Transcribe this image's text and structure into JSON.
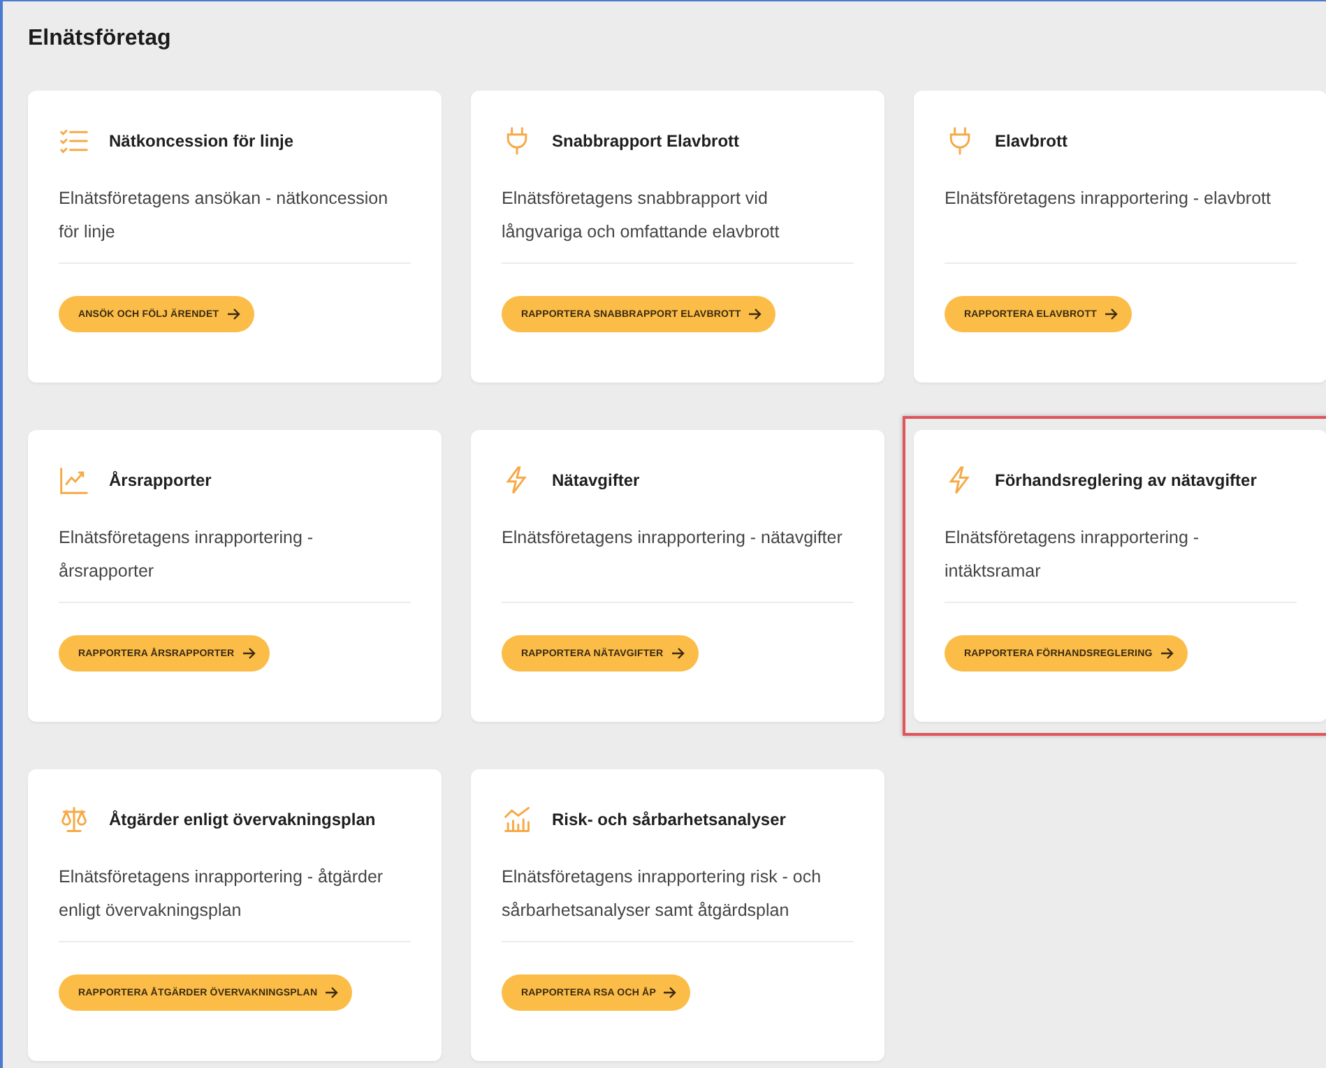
{
  "heading": "Elnätsföretag",
  "cards": [
    {
      "kind": "checklist",
      "title": "Nätkoncession för linje",
      "description": "Elnätsföretagens ansökan - nätkoncession för linje",
      "button": "ANSÖK OCH FÖLJ ÄRENDET",
      "highlighted": false
    },
    {
      "kind": "plug",
      "title": "Snabbrapport Elavbrott",
      "description": "Elnätsföretagens snabbrapport vid långvariga och omfattande elavbrott",
      "button": "RAPPORTERA SNABBRAPPORT ELAVBROTT",
      "highlighted": false
    },
    {
      "kind": "plug",
      "title": "Elavbrott",
      "description": "Elnätsföretagens inrapportering - elavbrott",
      "button": "RAPPORTERA ELAVBROTT",
      "highlighted": false
    },
    {
      "kind": "trend",
      "title": "Årsrapporter",
      "description": "Elnätsföretagens inrapportering - årsrapporter",
      "button": "RAPPORTERA ÅRSRAPPORTER",
      "highlighted": false
    },
    {
      "kind": "bolt",
      "title": "Nätavgifter",
      "description": "Elnätsföretagens inrapportering - nätavgifter",
      "button": "RAPPORTERA NÄTAVGIFTER",
      "highlighted": false
    },
    {
      "kind": "bolt",
      "title": "Förhandsreglering av nätavgifter",
      "description": "Elnätsföretagens inrapportering - intäktsramar",
      "button": "RAPPORTERA FÖRHANDSREGLERING",
      "highlighted": true
    },
    {
      "kind": "scales",
      "title": "Åtgärder enligt övervakningsplan",
      "description": "Elnätsföretagens inrapportering - åtgärder enligt övervakningsplan",
      "button": "RAPPORTERA ÅTGÄRDER ÖVERVAKNINGSPLAN",
      "highlighted": false
    },
    {
      "kind": "bars",
      "title": "Risk- och sårbarhetsanalyser",
      "description": "Elnätsföretagens inrapportering risk - och sårbarhetsanalyser samt åtgärdsplan",
      "button": "RAPPORTERA RSA OCH ÅP",
      "highlighted": false
    }
  ]
}
